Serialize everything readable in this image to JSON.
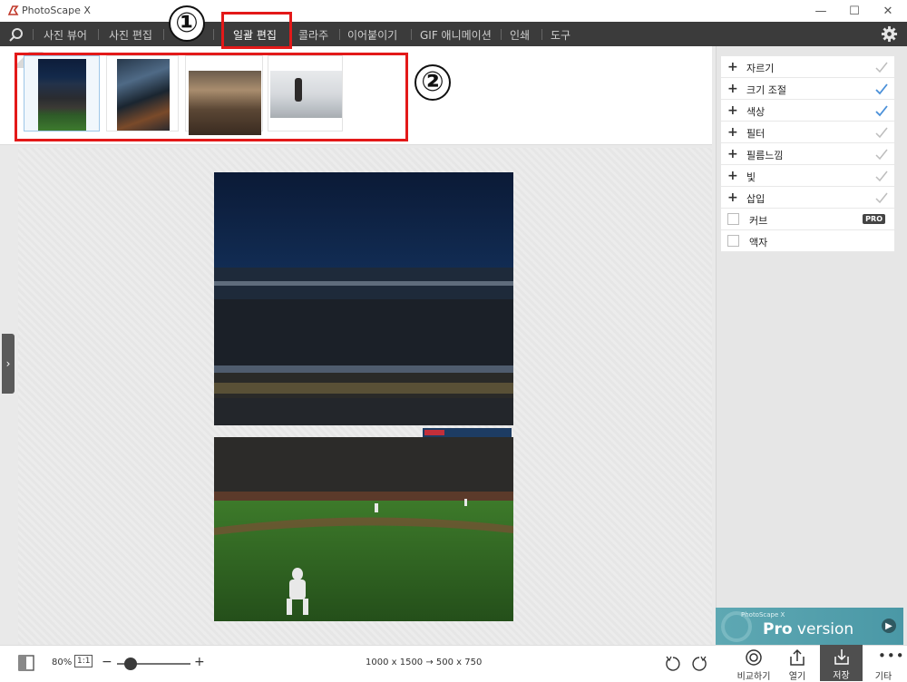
{
  "window": {
    "title": "PhotoScape X",
    "minimize": "—",
    "maximize": "☐",
    "close": "✕"
  },
  "menu": {
    "items": [
      "사진 뷰어",
      "사진 편집",
      "일괄 편집",
      "콜라주",
      "이어붙이기",
      "GIF 애니메이션",
      "인쇄",
      "도구"
    ],
    "active": "일괄 편집"
  },
  "annotations": {
    "circle1": "①",
    "circle2": "②"
  },
  "tools": [
    {
      "label": "자르기",
      "check_color": "#bdbdbd"
    },
    {
      "label": "크기 조절",
      "check_color": "#4a90d9"
    },
    {
      "label": "색상",
      "check_color": "#4a90d9"
    },
    {
      "label": "필터",
      "check_color": "#bdbdbd"
    },
    {
      "label": "필름느낌",
      "check_color": "#bdbdbd"
    },
    {
      "label": "빛",
      "check_color": "#bdbdbd"
    },
    {
      "label": "삽입",
      "check_color": "#bdbdbd"
    }
  ],
  "extra_tools": [
    {
      "label": "커브",
      "badge": "PRO"
    },
    {
      "label": "액자"
    }
  ],
  "pro_banner": {
    "small": "PhotoScape X",
    "pro": "Pro",
    "version": " version"
  },
  "bottom": {
    "zoom": "80%",
    "one_to_one": "1:1",
    "minus": "−",
    "plus": "+",
    "resize_info": "1000 x 1500 → 500 x 750",
    "compare": "비교하기",
    "open": "열기",
    "save": "저장",
    "more": "기타"
  },
  "colors": {
    "annotation": "#e31919",
    "menubar": "#3b3b3b",
    "check_blue": "#4a90d9"
  }
}
